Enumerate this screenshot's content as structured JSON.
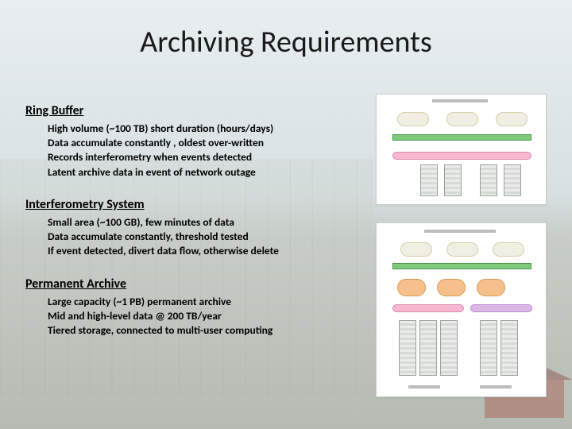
{
  "title": "Archiving Requirements",
  "sections": {
    "ring_buffer": {
      "heading": "Ring Buffer",
      "items": [
        "High volume (~100 TB) short duration (hours/days)",
        "Data accumulate constantly , oldest over-written",
        "Records interferometry when events detected",
        "Latent archive data in event of network outage"
      ]
    },
    "interferometry": {
      "heading": "Interferometry System",
      "items": [
        "Small area (~100 GB), few minutes of data",
        "Data accumulate constantly, threshold tested",
        "If event detected, divert data flow, otherwise delete"
      ]
    },
    "archive": {
      "heading": "Permanent Archive",
      "items": [
        "Large capacity (~1 PB) permanent archive",
        "Mid and high-level data @ 200 TB/year",
        "Tiered storage, connected to multi-user computing"
      ]
    }
  }
}
